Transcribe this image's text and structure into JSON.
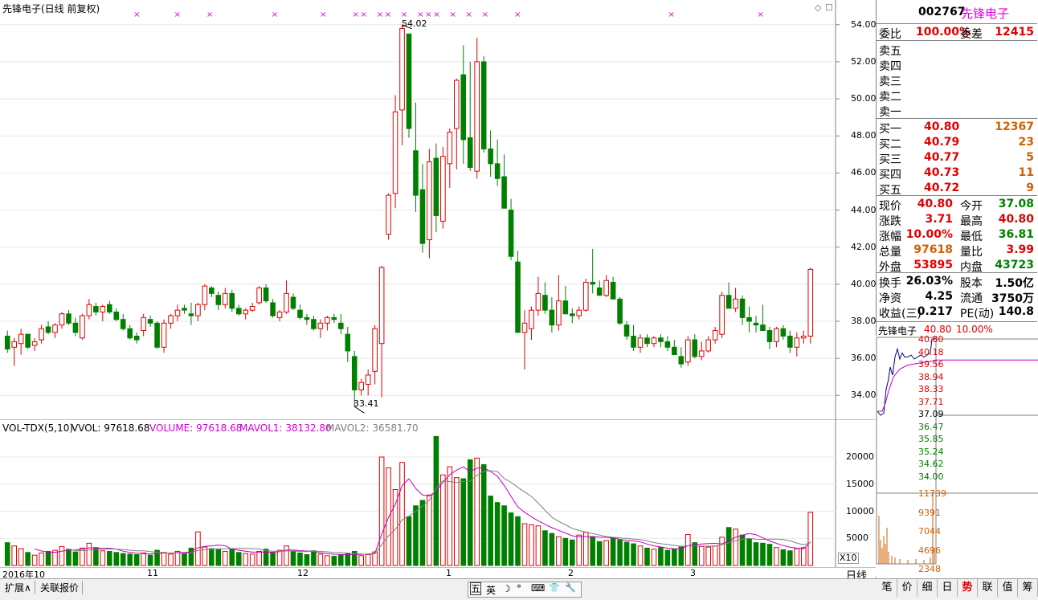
{
  "chart_header": {
    "title": "先锋电子(日线 前复权)",
    "price_ticks": [
      "54.00",
      "52.00",
      "50.00",
      "48.00",
      "46.00",
      "44.00",
      "42.00",
      "40.00",
      "38.00",
      "36.00",
      "34.00"
    ],
    "high_label": "54.02",
    "low_label": "33.41"
  },
  "volume_header": {
    "indicator": "VOL-TDX(5,10)",
    "vvol": "VVOL: 97618.68",
    "volume": "VOLUME: 97618.68",
    "mavol1": "MAVOL1: 38132.80",
    "mavol2": "MAVOL2: 36581.70",
    "ticks": [
      "20000",
      "15000",
      "10000",
      "5000"
    ],
    "unit": "X10"
  },
  "date_axis": {
    "labels": [
      "2016年10",
      "11",
      "12",
      "1",
      "2",
      "3"
    ],
    "period": "日线"
  },
  "bottom_tabs": [
    "扩展∧",
    "关联报价"
  ],
  "ime_bar": [
    "五",
    "英",
    "☽",
    "°",
    "⌨",
    "👕",
    "🔧"
  ],
  "right_tabs": [
    "笔",
    "价",
    "细",
    "日",
    "势",
    "联",
    "值",
    "筹"
  ],
  "quote": {
    "code": "002767",
    "name": "先锋电子",
    "weibi_label": "委比",
    "weibi": "100.00%",
    "weicha_label": "委差",
    "weicha": "12415",
    "sell": [
      {
        "label": "卖五"
      },
      {
        "label": "卖四"
      },
      {
        "label": "卖三"
      },
      {
        "label": "卖二"
      },
      {
        "label": "卖一"
      }
    ],
    "buy": [
      {
        "label": "买一",
        "price": "40.80",
        "vol": "12367"
      },
      {
        "label": "买二",
        "price": "40.79",
        "vol": "23"
      },
      {
        "label": "买三",
        "price": "40.77",
        "vol": "5"
      },
      {
        "label": "买四",
        "price": "40.73",
        "vol": "11"
      },
      {
        "label": "买五",
        "price": "40.72",
        "vol": "9"
      }
    ],
    "stats": [
      {
        "l1": "现价",
        "v1": "40.80",
        "l2": "今开",
        "v2": "37.08",
        "c1": "red",
        "c2": "green"
      },
      {
        "l1": "涨跌",
        "v1": "3.71",
        "l2": "最高",
        "v2": "40.80",
        "c1": "red",
        "c2": "red"
      },
      {
        "l1": "涨幅",
        "v1": "10.00%",
        "l2": "最低",
        "v2": "36.81",
        "c1": "red",
        "c2": "green"
      },
      {
        "l1": "总量",
        "v1": "97618",
        "l2": "量比",
        "v2": "3.99",
        "c1": "orange",
        "c2": "red"
      },
      {
        "l1": "外盘",
        "v1": "53895",
        "l2": "内盘",
        "v2": "43723",
        "c1": "red",
        "c2": "green"
      }
    ],
    "fin": [
      {
        "l1": "换手",
        "v1": "26.03%",
        "l2": "股本",
        "v2": "1.50亿"
      },
      {
        "l1": "净资",
        "v1": "4.25",
        "l2": "流通",
        "v2": "3750万"
      },
      {
        "l1": "收益(三)",
        "v1": "0.217",
        "l2": "PE(动)",
        "v2": "140.8"
      }
    ],
    "mini_title": "先锋电子",
    "mini_price": "40.80",
    "mini_pct": "10.00%",
    "mini_price_ticks": [
      "40.80",
      "40.18",
      "39.56",
      "38.94",
      "38.33",
      "37.71",
      "37.09",
      "36.47",
      "35.85",
      "35.24",
      "34.62",
      "34.00"
    ],
    "mini_vol_ticks": [
      "11739",
      "9391",
      "7044",
      "4696",
      "2348"
    ]
  },
  "colors": {
    "up": "#e00000",
    "down": "#008000",
    "ma1": "#c000c0",
    "ma2": "#808080",
    "grid": "#e8e8e8"
  },
  "chart_data": {
    "type": "candlestick",
    "y_range": [
      32.8,
      54.9
    ],
    "vol_range": [
      0,
      24000
    ],
    "candles": [
      [
        37.2,
        37.5,
        36.3,
        36.5,
        4200
      ],
      [
        36.6,
        37.1,
        35.6,
        36.9,
        3600
      ],
      [
        36.8,
        37.6,
        36.2,
        37.3,
        3100
      ],
      [
        37.3,
        37.3,
        36.5,
        36.6,
        2400
      ],
      [
        36.7,
        37.1,
        36.4,
        36.9,
        1900
      ],
      [
        37.0,
        37.8,
        36.8,
        37.6,
        2300
      ],
      [
        37.7,
        38.0,
        37.3,
        37.4,
        2600
      ],
      [
        37.4,
        37.9,
        37.1,
        37.8,
        2800
      ],
      [
        37.8,
        38.5,
        37.6,
        38.4,
        3500
      ],
      [
        38.4,
        38.6,
        37.8,
        37.9,
        3000
      ],
      [
        37.9,
        38.2,
        37.2,
        37.4,
        2500
      ],
      [
        37.1,
        38.4,
        37.0,
        38.3,
        3200
      ],
      [
        38.3,
        39.2,
        38.1,
        38.9,
        4100
      ],
      [
        38.8,
        39.0,
        38.3,
        38.5,
        3300
      ],
      [
        38.5,
        38.9,
        38.0,
        38.8,
        2700
      ],
      [
        38.9,
        39.1,
        38.4,
        38.5,
        2600
      ],
      [
        38.5,
        38.7,
        38.0,
        38.1,
        2400
      ],
      [
        38.1,
        38.4,
        37.5,
        37.6,
        2200
      ],
      [
        37.6,
        37.8,
        37.0,
        37.1,
        2100
      ],
      [
        37.2,
        37.4,
        36.8,
        37.0,
        2000
      ],
      [
        37.5,
        38.4,
        37.2,
        38.2,
        2300
      ],
      [
        38.1,
        38.3,
        37.7,
        37.9,
        1900
      ],
      [
        37.9,
        38.0,
        36.5,
        36.6,
        2800
      ],
      [
        36.6,
        38.1,
        36.3,
        37.9,
        2400
      ],
      [
        37.9,
        38.4,
        37.6,
        38.3,
        2100
      ],
      [
        38.3,
        38.9,
        38.0,
        38.6,
        2600
      ],
      [
        38.7,
        38.9,
        38.4,
        38.6,
        2200
      ],
      [
        38.4,
        39.0,
        37.8,
        38.3,
        3200
      ],
      [
        38.3,
        39.0,
        38.0,
        38.9,
        6200
      ],
      [
        38.9,
        40.0,
        38.6,
        39.9,
        3400
      ],
      [
        39.8,
        39.9,
        39.3,
        39.5,
        3100
      ],
      [
        39.4,
        39.6,
        38.6,
        38.9,
        2900
      ],
      [
        38.9,
        39.8,
        38.7,
        39.5,
        2600
      ],
      [
        39.5,
        39.7,
        38.5,
        38.7,
        3000
      ],
      [
        38.7,
        38.9,
        38.3,
        38.4,
        2400
      ],
      [
        38.4,
        38.7,
        38.1,
        38.6,
        2200
      ],
      [
        38.6,
        39.0,
        38.5,
        38.8,
        2100
      ],
      [
        39.0,
        39.9,
        38.9,
        39.8,
        2600
      ],
      [
        39.8,
        40.0,
        39.0,
        39.1,
        3000
      ],
      [
        39.0,
        39.2,
        38.2,
        38.3,
        2300
      ],
      [
        38.2,
        38.6,
        38.0,
        38.5,
        2800
      ],
      [
        38.5,
        40.2,
        38.4,
        39.5,
        3600
      ],
      [
        39.3,
        39.5,
        38.6,
        38.7,
        2600
      ],
      [
        38.6,
        38.9,
        38.1,
        38.2,
        2300
      ],
      [
        38.2,
        38.4,
        37.8,
        38.1,
        2000
      ],
      [
        38.1,
        38.3,
        37.5,
        37.6,
        2700
      ],
      [
        37.6,
        38.1,
        37.1,
        37.9,
        2100
      ],
      [
        37.9,
        38.3,
        37.5,
        38.2,
        1800
      ],
      [
        38.2,
        38.4,
        37.9,
        38.1,
        1700
      ],
      [
        37.9,
        38.4,
        37.3,
        37.6,
        1900
      ],
      [
        37.3,
        37.7,
        35.8,
        36.4,
        2200
      ],
      [
        36.1,
        36.4,
        33.4,
        34.3,
        2600
      ],
      [
        34.3,
        34.9,
        34.0,
        34.7,
        1800
      ],
      [
        34.6,
        35.4,
        34.0,
        35.1,
        2000
      ],
      [
        35.3,
        37.8,
        34.6,
        37.6,
        2500
      ],
      [
        36.8,
        41.0,
        33.9,
        40.9,
        20000
      ],
      [
        42.7,
        44.9,
        42.4,
        44.8,
        18000
      ],
      [
        44.9,
        50.2,
        44.1,
        49.3,
        14000
      ],
      [
        49.4,
        54.0,
        47.5,
        53.8,
        19000
      ],
      [
        53.5,
        53.5,
        47.9,
        48.4,
        9000
      ],
      [
        47.2,
        49.8,
        43.9,
        44.8,
        11000
      ],
      [
        45.1,
        46.5,
        41.7,
        42.2,
        12000
      ],
      [
        42.4,
        47.3,
        41.4,
        46.6,
        13000
      ],
      [
        46.8,
        47.6,
        42.8,
        43.7,
        23800
      ],
      [
        43.4,
        47.4,
        43.0,
        46.9,
        16700
      ],
      [
        46.5,
        48.4,
        45.2,
        48.2,
        18200
      ],
      [
        48.4,
        51.1,
        46.2,
        51.0,
        16200
      ],
      [
        51.3,
        52.9,
        46.5,
        47.8,
        16000
      ],
      [
        47.9,
        52.0,
        46.1,
        46.3,
        19500
      ],
      [
        46.1,
        53.3,
        45.7,
        52.0,
        19800
      ],
      [
        52.0,
        52.3,
        47.1,
        47.3,
        18600
      ],
      [
        47.3,
        48.3,
        45.8,
        46.5,
        12800
      ],
      [
        46.5,
        47.8,
        45.3,
        45.7,
        11600
      ],
      [
        45.8,
        47.0,
        44.5,
        44.1,
        11000
      ],
      [
        44.0,
        44.6,
        41.3,
        41.5,
        9700
      ],
      [
        41.2,
        41.8,
        37.4,
        37.4,
        9000
      ],
      [
        37.4,
        38.6,
        35.4,
        37.9,
        7700
      ],
      [
        37.6,
        38.8,
        37.0,
        38.6,
        7500
      ],
      [
        38.6,
        40.4,
        38.3,
        39.5,
        7300
      ],
      [
        39.4,
        40.1,
        38.4,
        38.6,
        6400
      ],
      [
        38.6,
        39.3,
        37.4,
        37.8,
        5900
      ],
      [
        37.8,
        40.5,
        37.5,
        39.1,
        5300
      ],
      [
        39.1,
        39.9,
        38.6,
        38.4,
        5000
      ],
      [
        38.4,
        38.7,
        37.9,
        38.3,
        4700
      ],
      [
        38.3,
        38.8,
        38.1,
        38.6,
        5600
      ],
      [
        38.6,
        40.3,
        38.5,
        40.1,
        6100
      ],
      [
        40.1,
        41.9,
        39.5,
        40.0,
        5300
      ],
      [
        39.8,
        40.2,
        39.4,
        39.4,
        4400
      ],
      [
        39.4,
        40.5,
        39.3,
        40.2,
        4600
      ],
      [
        40.1,
        40.4,
        39.2,
        39.2,
        5100
      ],
      [
        39.2,
        39.3,
        37.8,
        37.9,
        4700
      ],
      [
        37.8,
        38.0,
        37.0,
        37.2,
        4300
      ],
      [
        37.2,
        37.8,
        36.4,
        36.6,
        4000
      ],
      [
        36.6,
        37.3,
        36.3,
        37.1,
        3600
      ],
      [
        37.1,
        37.3,
        36.6,
        36.8,
        3200
      ],
      [
        36.8,
        37.2,
        36.6,
        37.1,
        3000
      ],
      [
        37.1,
        37.3,
        36.6,
        36.9,
        3300
      ],
      [
        36.9,
        37.2,
        36.4,
        36.6,
        2800
      ],
      [
        36.6,
        37.0,
        36.3,
        36.2,
        3000
      ],
      [
        36.1,
        36.6,
        35.5,
        35.7,
        3400
      ],
      [
        35.8,
        37.2,
        35.6,
        37.0,
        5700
      ],
      [
        37.0,
        37.3,
        36.0,
        36.1,
        4200
      ],
      [
        36.1,
        36.9,
        35.9,
        36.4,
        3500
      ],
      [
        36.4,
        37.2,
        36.3,
        37.0,
        3400
      ],
      [
        37.0,
        37.7,
        36.8,
        37.5,
        3600
      ],
      [
        37.3,
        39.6,
        37.1,
        39.4,
        5200
      ],
      [
        39.4,
        40.1,
        38.7,
        38.7,
        7000
      ],
      [
        38.7,
        39.8,
        38.5,
        39.2,
        6700
      ],
      [
        39.2,
        39.4,
        37.8,
        38.2,
        5600
      ],
      [
        38.2,
        38.8,
        37.4,
        38.0,
        4900
      ],
      [
        37.9,
        38.3,
        37.4,
        37.8,
        4200
      ],
      [
        37.8,
        38.9,
        37.5,
        37.5,
        4100
      ],
      [
        37.5,
        37.7,
        36.5,
        36.9,
        3900
      ],
      [
        36.9,
        37.7,
        36.6,
        37.6,
        3300
      ],
      [
        37.6,
        37.8,
        37.0,
        37.2,
        2900
      ],
      [
        37.2,
        37.5,
        36.3,
        36.6,
        2700
      ],
      [
        36.6,
        37.4,
        36.1,
        37.1,
        3100
      ],
      [
        37.1,
        37.5,
        36.8,
        37.2,
        3300
      ],
      [
        37.2,
        40.9,
        36.8,
        40.8,
        9800
      ]
    ]
  }
}
